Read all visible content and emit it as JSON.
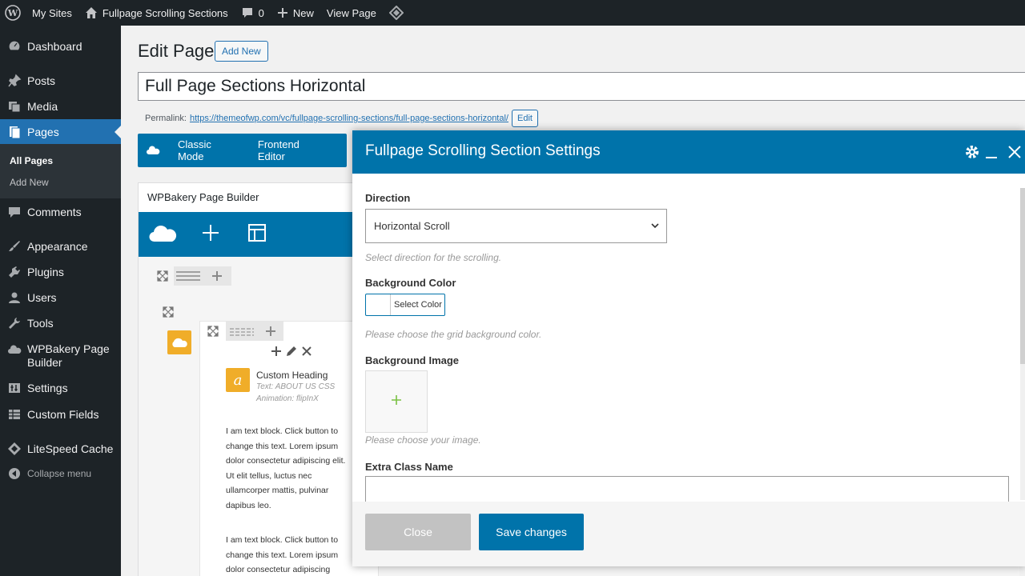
{
  "adminbar": {
    "my_sites": "My Sites",
    "site_name": "Fullpage Scrolling Sections",
    "comments_count": "0",
    "new_label": "New",
    "view_page": "View Page"
  },
  "sidebar": {
    "items": [
      {
        "label": "Dashboard",
        "icon": "dashboard-icon"
      },
      {
        "label": "Posts",
        "icon": "pin-icon"
      },
      {
        "label": "Media",
        "icon": "media-icon"
      },
      {
        "label": "Pages",
        "icon": "pages-icon"
      },
      {
        "label": "Comments",
        "icon": "comment-icon"
      },
      {
        "label": "Appearance",
        "icon": "brush-icon"
      },
      {
        "label": "Plugins",
        "icon": "plugin-icon"
      },
      {
        "label": "Users",
        "icon": "user-icon"
      },
      {
        "label": "Tools",
        "icon": "wrench-icon"
      },
      {
        "label": "WPBakery Page Builder",
        "icon": "cloud-icon"
      },
      {
        "label": "Settings",
        "icon": "settings-icon"
      },
      {
        "label": "Custom Fields",
        "icon": "grid-icon"
      },
      {
        "label": "LiteSpeed Cache",
        "icon": "diamond-icon"
      },
      {
        "label": "Collapse menu",
        "icon": "collapse-icon"
      }
    ],
    "submenu": {
      "all_pages": "All Pages",
      "add_new": "Add New"
    }
  },
  "page": {
    "heading": "Edit Page",
    "add_new": "Add New",
    "title_value": "Full Page Sections Horizontal",
    "permalink_label": "Permalink:",
    "permalink_url": "https://themeofwp.com/vc/fullpage-scrolling-sections/full-page-sections-horizontal/",
    "permalink_edit": "Edit"
  },
  "modes": {
    "classic": "Classic Mode",
    "frontend": "Frontend Editor"
  },
  "builder": {
    "title": "WPBakery Page Builder",
    "element_title": "Custom Heading",
    "element_text": "Text: ABOUT US CSS",
    "element_animation": "Animation: flipInX",
    "text_block_1": "I am text block. Click button to change this text. Lorem ipsum dolor consectetur adipiscing elit. Ut elit tellus, luctus nec ullamcorper mattis, pulvinar dapibus leo.",
    "text_block_2": "I am text block. Click button to change this text. Lorem ipsum dolor consectetur adipiscing"
  },
  "modal": {
    "title": "Fullpage Scrolling Section Settings",
    "direction_label": "Direction",
    "direction_value": "Horizontal Scroll",
    "direction_help": "Select direction for the scrolling.",
    "bg_color_label": "Background Color",
    "select_color": "Select Color",
    "bg_color_help": "Please choose the grid background color.",
    "bg_image_label": "Background Image",
    "bg_image_help": "Please choose your image.",
    "extra_class_label": "Extra Class Name",
    "extra_class_value": "",
    "close_btn": "Close",
    "save_btn": "Save changes"
  },
  "colors": {
    "admin_dark": "#1d2327",
    "accent": "#2271b1",
    "wpb_blue": "#0073aa",
    "element_yellow": "#f0ad29"
  }
}
